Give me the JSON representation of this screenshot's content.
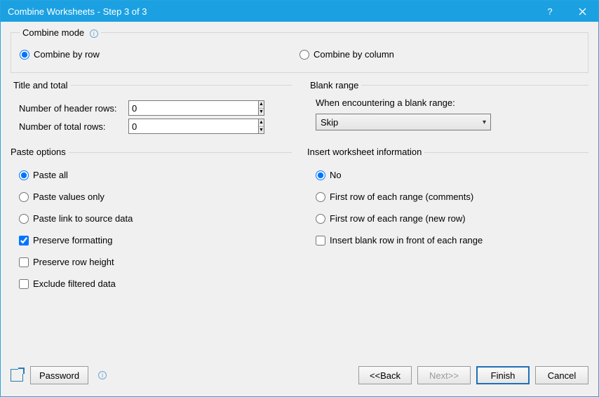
{
  "window": {
    "title": "Combine Worksheets - Step 3 of 3"
  },
  "combine_mode": {
    "legend": "Combine mode",
    "by_row": "Combine by row",
    "by_column": "Combine by column",
    "selected": "row"
  },
  "title_total": {
    "legend": "Title and total",
    "header_label": "Number of header rows:",
    "header_value": "0",
    "total_label": "Number of total rows:",
    "total_value": "0"
  },
  "blank_range": {
    "legend": "Blank range",
    "prompt": "When encountering a blank range:",
    "value": "Skip"
  },
  "paste_options": {
    "legend": "Paste options",
    "paste_all": "Paste all",
    "paste_values": "Paste values only",
    "paste_link": "Paste link to source data",
    "preserve_format": "Preserve formatting",
    "preserve_height": "Preserve row height",
    "exclude_filtered": "Exclude filtered data",
    "selected_radio": "all",
    "preserve_format_checked": true,
    "preserve_height_checked": false,
    "exclude_filtered_checked": false
  },
  "insert_info": {
    "legend": "Insert worksheet information",
    "no": "No",
    "first_comments": "First row of each range (comments)",
    "first_newrow": "First row of each range (new row)",
    "insert_blank": "Insert blank row in front of each range",
    "selected_radio": "no",
    "insert_blank_checked": false
  },
  "footer": {
    "password": "Password",
    "back": "<<Back",
    "next": "Next>>",
    "finish": "Finish",
    "cancel": "Cancel"
  }
}
